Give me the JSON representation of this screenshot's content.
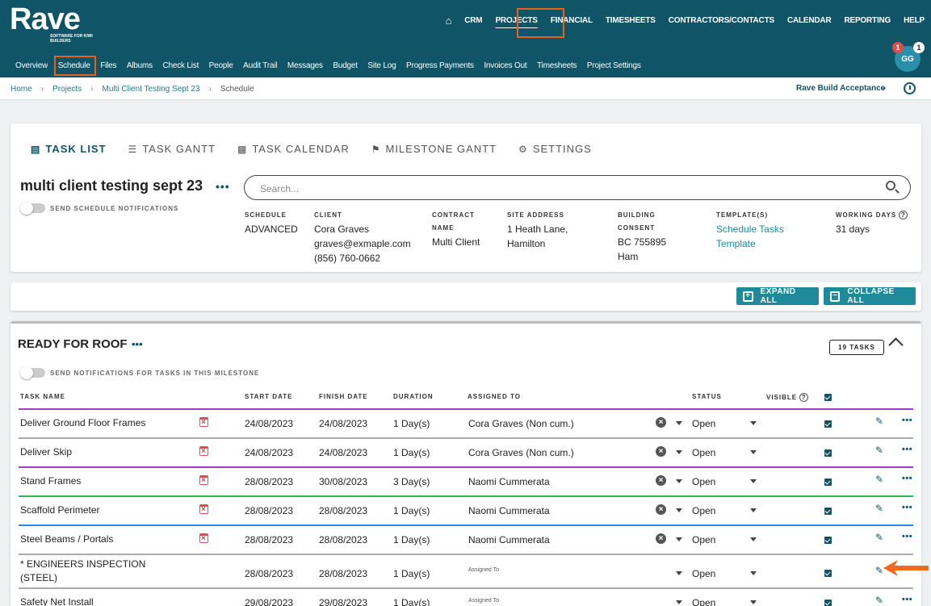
{
  "brand": {
    "name": "Rave",
    "tagline": "SOFTWARE FOR KIWI BUILDERS"
  },
  "topnav": [
    {
      "label": "CRM"
    },
    {
      "label": "PROJECTS"
    },
    {
      "label": "FINANCIAL"
    },
    {
      "label": "TIMESHEETS"
    },
    {
      "label": "CONTRACTORS/CONTACTS"
    },
    {
      "label": "CALENDAR"
    },
    {
      "label": "REPORTING"
    },
    {
      "label": "HELP"
    }
  ],
  "subnav": [
    "Overview",
    "Schedule",
    "Files",
    "Albums",
    "Check List",
    "People",
    "Audit Trail",
    "Messages",
    "Budget",
    "Site Log",
    "Progress Payments",
    "Invoices Out",
    "Timesheets",
    "Project Settings"
  ],
  "user": {
    "initials": "GG",
    "badge_red": "1",
    "badge_white": "1"
  },
  "breadcrumb": {
    "home": "Home",
    "projects": "Projects",
    "project": "Multi Client Testing Sept 23",
    "current": "Schedule"
  },
  "account": "Rave Build Acceptance",
  "tabs": [
    {
      "label": "TASK LIST",
      "icon": "clipboard-icon"
    },
    {
      "label": "TASK GANTT",
      "icon": "list-icon"
    },
    {
      "label": "TASK CALENDAR",
      "icon": "calendar-icon"
    },
    {
      "label": "MILESTONE GANTT",
      "icon": "flag-icon"
    },
    {
      "label": "SETTINGS",
      "icon": "gears-icon"
    }
  ],
  "project": {
    "title": "multi client testing sept 23",
    "notify_label": "SEND SCHEDULE NOTIFICATIONS"
  },
  "search": {
    "placeholder": "Search..."
  },
  "info": {
    "schedule_label": "SCHEDULE",
    "schedule": "ADVANCED",
    "client_label": "CLIENT",
    "client_name": "Cora Graves",
    "client_email": "graves@exmaple.com",
    "client_phone": "(856) 760-0662",
    "contract_label1": "CONTRACT",
    "contract_label2": "NAME",
    "contract": "Multi Client",
    "site_label": "SITE ADDRESS",
    "site1": "1 Heath Lane,",
    "site2": "Hamilton",
    "building_label1": "BUILDING",
    "building_label2": "CONSENT",
    "building1": "BC 755895",
    "building2": "Ham",
    "template_label": "TEMPLATE(S)",
    "template1": "Schedule Tasks",
    "template2": "Template",
    "working_label": "WORKING DAYS",
    "working": "31 days"
  },
  "actions": {
    "expand": "EXPAND ALL",
    "collapse": "COLLAPSE ALL"
  },
  "milestone": {
    "title": "READY FOR ROOF",
    "task_count": "19 TASKS",
    "notify_label": "SEND NOTIFICATIONS FOR TASKS IN THIS MILESTONE"
  },
  "columns": {
    "task": "TASK NAME",
    "start": "START DATE",
    "finish": "FINISH DATE",
    "duration": "DURATION",
    "assigned": "ASSIGNED TO",
    "status": "STATUS",
    "visible": "VISIBLE"
  },
  "tasks": [
    {
      "name": "Deliver Ground Floor Frames",
      "start": "24/08/2023",
      "finish": "24/08/2023",
      "duration": "1 Day(s)",
      "assigned": "Cora Graves (Non cum.)",
      "status": "Open",
      "color": "#9b3fbf"
    },
    {
      "name": "Deliver Skip",
      "start": "24/08/2023",
      "finish": "24/08/2023",
      "duration": "1 Day(s)",
      "assigned": "Cora Graves (Non cum.)",
      "status": "Open",
      "color": "#aaaaaa"
    },
    {
      "name": "Stand Frames",
      "start": "28/08/2023",
      "finish": "30/08/2023",
      "duration": "3 Day(s)",
      "assigned": "Naomi Cummerata",
      "status": "Open",
      "color": "#9b3fbf"
    },
    {
      "name": "Scaffold Perimeter",
      "start": "28/08/2023",
      "finish": "28/08/2023",
      "duration": "1 Day(s)",
      "assigned": "Naomi Cummerata",
      "status": "Open",
      "color": "#2cb84a"
    },
    {
      "name": "Steel Beams / Portals",
      "start": "28/08/2023",
      "finish": "28/08/2023",
      "duration": "1 Day(s)",
      "assigned": "Naomi Cummerata",
      "status": "Open",
      "color": "#2a8ad8"
    },
    {
      "name1": "* ENGINEERS INSPECTION",
      "name2": "(STEEL)",
      "start": "28/08/2023",
      "finish": "28/08/2023",
      "duration": "1 Day(s)",
      "assigned_placeholder": "Assigned To",
      "status": "Open",
      "color": "#aaaaaa"
    },
    {
      "name": "Safety Net Install",
      "start": "29/08/2023",
      "finish": "29/08/2023",
      "duration": "1 Day(s)",
      "assigned_placeholder": "Assigned To",
      "status": "Open",
      "color": "#aaaaaa"
    }
  ]
}
